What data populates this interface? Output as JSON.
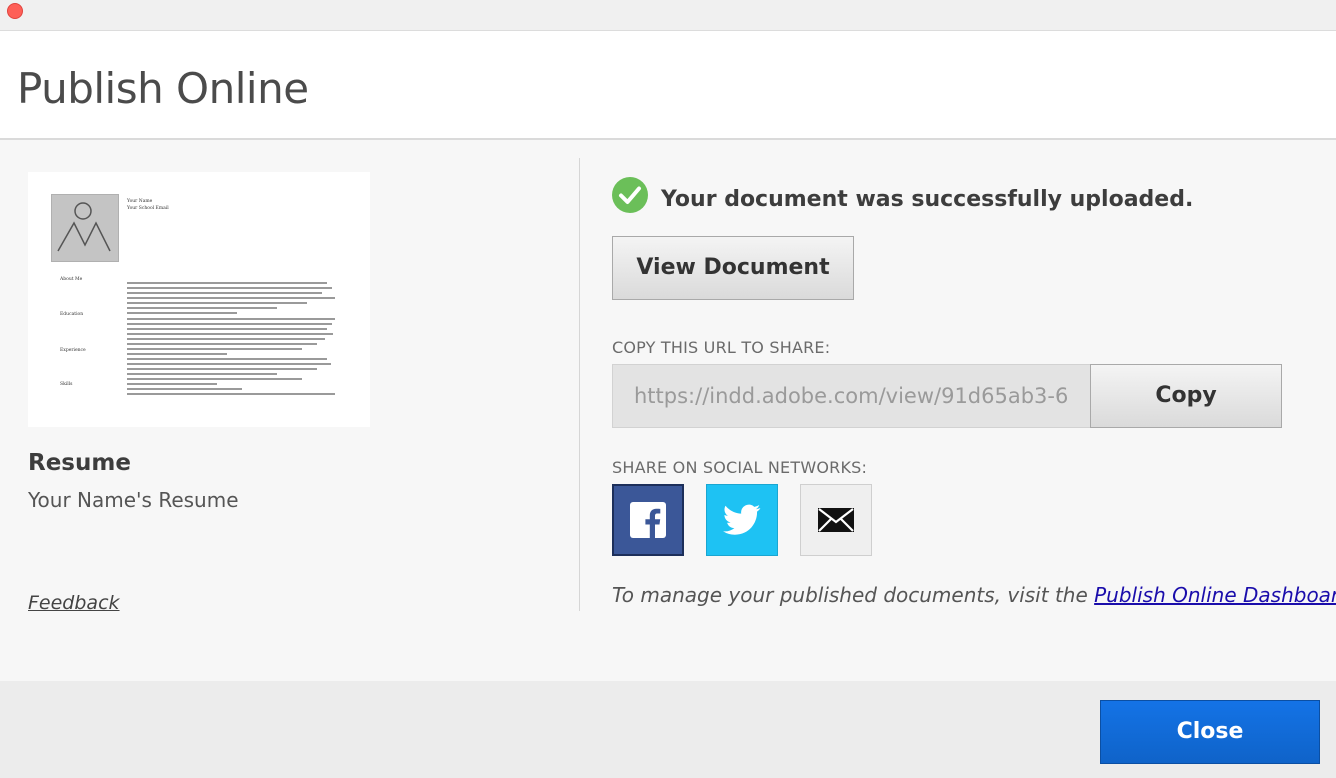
{
  "window": {
    "title": "Publish Online"
  },
  "left": {
    "thumbnail": {
      "name_line": "Your Name",
      "email_line": "Your School Email",
      "sections": [
        "About Me",
        "Education",
        "Experience",
        "Skills"
      ]
    },
    "doc_title": "Resume",
    "doc_subtitle": "Your Name's Resume",
    "feedback_label": "Feedback"
  },
  "right": {
    "success_message": "Your document was successfully uploaded.",
    "view_button": "View Document",
    "copy_url_label": "COPY THIS URL TO SHARE:",
    "url_value": "https://indd.adobe.com/view/91d65ab3-6",
    "copy_button": "Copy",
    "social_label": "SHARE ON SOCIAL NETWORKS:",
    "social": [
      {
        "name": "facebook",
        "icon": "facebook-icon",
        "color": "#3b5798"
      },
      {
        "name": "twitter",
        "icon": "twitter-icon",
        "color": "#1ec2f3"
      },
      {
        "name": "email",
        "icon": "envelope-icon",
        "color": "#efefef"
      }
    ],
    "manage_text": "To manage your published documents, visit the ",
    "dashboard_link": "Publish Online Dashboard",
    "manage_suffix": "."
  },
  "footer": {
    "close_button": "Close",
    "accent": "#1473e6"
  },
  "status": {
    "success_color": "#6bbf59"
  }
}
